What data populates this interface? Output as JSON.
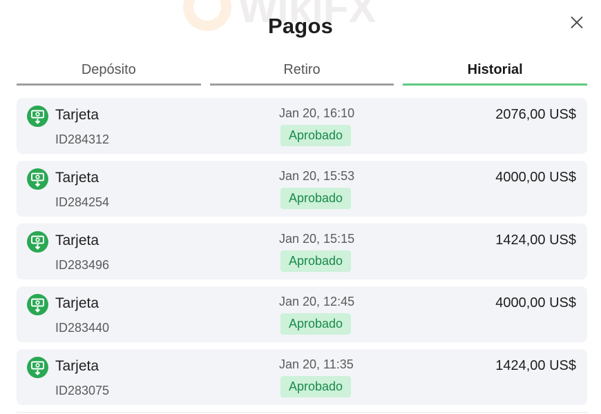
{
  "header": {
    "title": "Pagos",
    "close_icon": "close-icon"
  },
  "tabs": [
    {
      "label": "Depósito",
      "active": false
    },
    {
      "label": "Retiro",
      "active": false
    },
    {
      "label": "Historial",
      "active": true
    }
  ],
  "colors": {
    "accent": "#5cc97e",
    "icon_green": "#2aa853",
    "status_bg": "#cdf1d9",
    "status_text": "#198a4a",
    "row_bg": "#f3f4f8"
  },
  "transactions": [
    {
      "icon": "card-deposit-icon",
      "method": "Tarjeta",
      "id": "ID284312",
      "date": "Jan 20, 16:10",
      "status": "Aprobado",
      "amount": "2076,00 US$"
    },
    {
      "icon": "card-deposit-icon",
      "method": "Tarjeta",
      "id": "ID284254",
      "date": "Jan 20, 15:53",
      "status": "Aprobado",
      "amount": "4000,00 US$"
    },
    {
      "icon": "card-deposit-icon",
      "method": "Tarjeta",
      "id": "ID283496",
      "date": "Jan 20, 15:15",
      "status": "Aprobado",
      "amount": "1424,00 US$"
    },
    {
      "icon": "card-deposit-icon",
      "method": "Tarjeta",
      "id": "ID283440",
      "date": "Jan 20, 12:45",
      "status": "Aprobado",
      "amount": "4000,00 US$"
    },
    {
      "icon": "card-deposit-icon",
      "method": "Tarjeta",
      "id": "ID283075",
      "date": "Jan 20, 11:35",
      "status": "Aprobado",
      "amount": "1424,00 US$"
    }
  ],
  "watermark": {
    "text": "WikiFX"
  }
}
